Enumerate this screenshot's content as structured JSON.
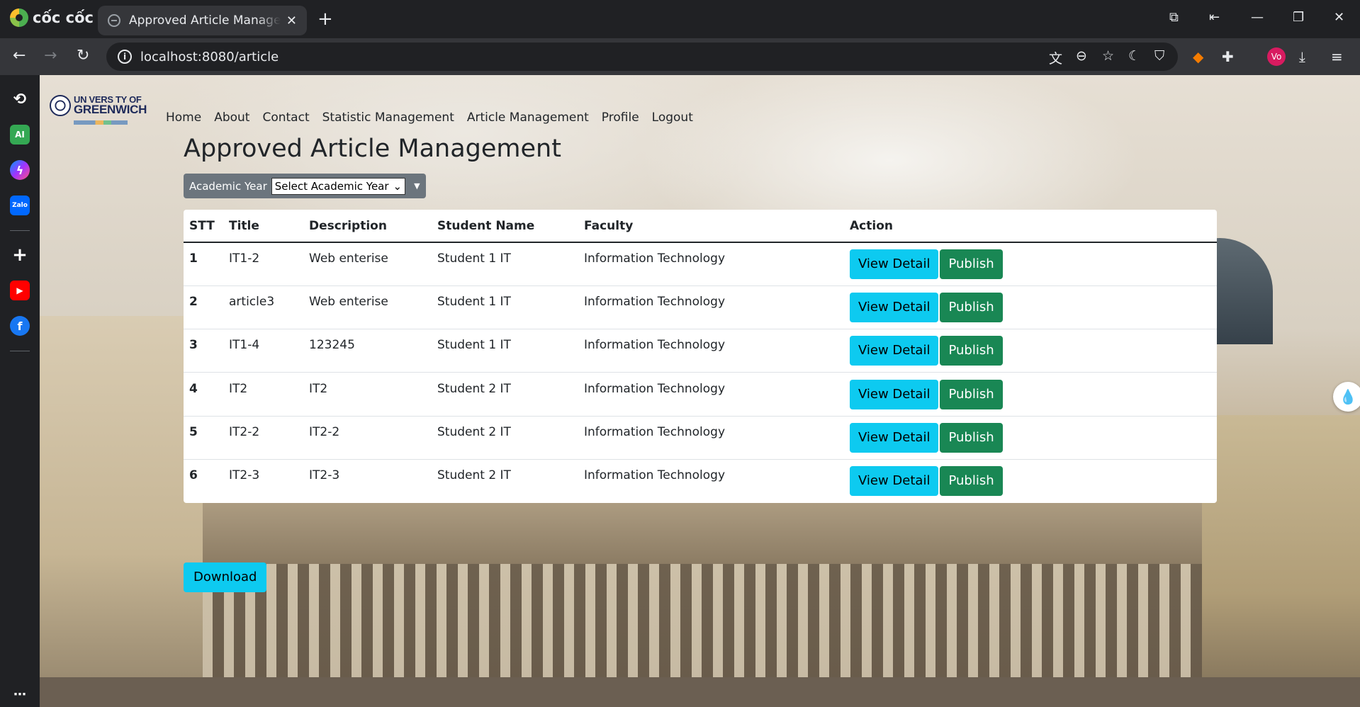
{
  "browser": {
    "brand": "cốc cốc",
    "tab_title": "Approved Article Management",
    "url": "localhost:8080/article",
    "profile_initials": "Vo"
  },
  "sidebar": {
    "items": [
      "history-icon",
      "ai-icon",
      "messenger-icon",
      "zalo-icon",
      "add-icon",
      "youtube-icon",
      "facebook-icon",
      "more-icon"
    ],
    "ai_label": "AI",
    "zalo_label": "Zalo"
  },
  "logo": {
    "line1": "UN VERS TY OF",
    "line2": "GREENWICH"
  },
  "nav": {
    "items": [
      "Home",
      "About",
      "Contact",
      "Statistic Management",
      "Article Management",
      "Profile",
      "Logout"
    ]
  },
  "main": {
    "title": "Approved Article Management",
    "filter": {
      "label": "Academic Year",
      "selected": "Select Academic Year"
    },
    "table": {
      "headers": [
        "STT",
        "Title",
        "Description",
        "Student Name",
        "Faculty",
        "Action"
      ],
      "rows": [
        [
          "1",
          "IT1-2",
          "Web enterise",
          "Student 1 IT",
          "Information Technology"
        ],
        [
          "2",
          "article3",
          "Web enterise",
          "Student 1 IT",
          "Information Technology"
        ],
        [
          "3",
          "IT1-4",
          "123245",
          "Student 1 IT",
          "Information Technology"
        ],
        [
          "4",
          "IT2",
          "IT2",
          "Student 2 IT",
          "Information Technology"
        ],
        [
          "5",
          "IT2-2",
          "IT2-2",
          "Student 2 IT",
          "Information Technology"
        ],
        [
          "6",
          "IT2-3",
          "IT2-3",
          "Student 2 IT",
          "Information Technology"
        ]
      ],
      "view_label": "View Detail",
      "publish_label": "Publish"
    },
    "download_label": "Download"
  },
  "colors": {
    "info": "#0dcaf0",
    "success": "#198754",
    "secondary": "#6c757d"
  }
}
